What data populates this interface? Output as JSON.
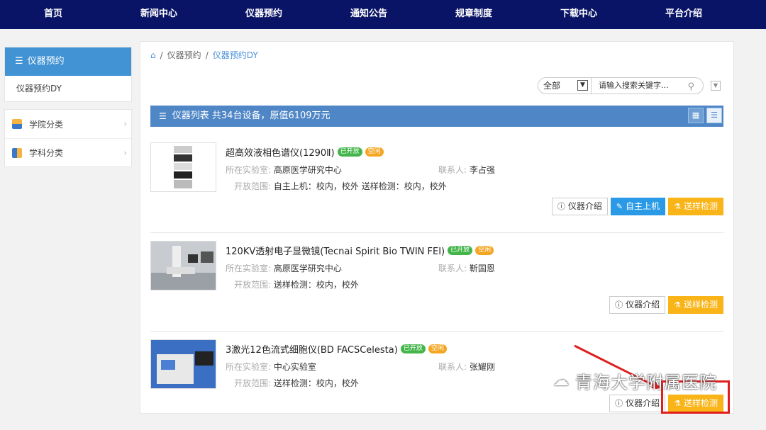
{
  "nav": [
    "首页",
    "新闻中心",
    "仪器预约",
    "通知公告",
    "规章制度",
    "下载中心",
    "平台介绍"
  ],
  "sidebar": {
    "active": "仪器预约",
    "sub": "仪器预约DY",
    "categories": [
      "学院分类",
      "学科分类"
    ]
  },
  "breadcrumb": {
    "level1": "仪器预约",
    "sep": "/",
    "current": "仪器预约DY"
  },
  "search": {
    "select_value": "全部",
    "placeholder": "请输入搜索关键字..."
  },
  "listbar": {
    "title": "仪器列表 共34台设备，原值6109万元"
  },
  "labels": {
    "lab": "所在实验室:",
    "contact": "联系人:",
    "scope": "开放范围:"
  },
  "buttons": {
    "info": "仪器介绍",
    "self": "自主上机",
    "sample": "送样检测"
  },
  "instruments": [
    {
      "name": "超高效液相色谱仪(1290Ⅱ)",
      "status_open": "已开放",
      "status_idle": "空闲",
      "lab": "高原医学研究中心",
      "contact": "李占强",
      "scope": "自主上机：校内，校外  送样检测：校内，校外"
    },
    {
      "name": "120KV透射电子显微镜(Tecnai Spirit Bio TWIN FEI)",
      "status_open": "已开放",
      "status_idle": "空闲",
      "lab": "高原医学研究中心",
      "contact": "靳国恩",
      "scope": "送样检测：校内，校外"
    },
    {
      "name": "3激光12色流式细胞仪(BD FACSCelesta)",
      "status_open": "已开放",
      "status_idle": "空闲",
      "lab": "中心实验室",
      "contact": "张耀刚",
      "scope": "送样检测：校内，校外"
    }
  ],
  "watermark": "青海大学附属医院",
  "colors": {
    "nav": "#0a1466",
    "accent": "#4193d4",
    "listbar": "#4f86c6",
    "self_btn": "#2a9ae6",
    "sample_btn": "#f9b418",
    "annotation": "#e01e1e"
  }
}
